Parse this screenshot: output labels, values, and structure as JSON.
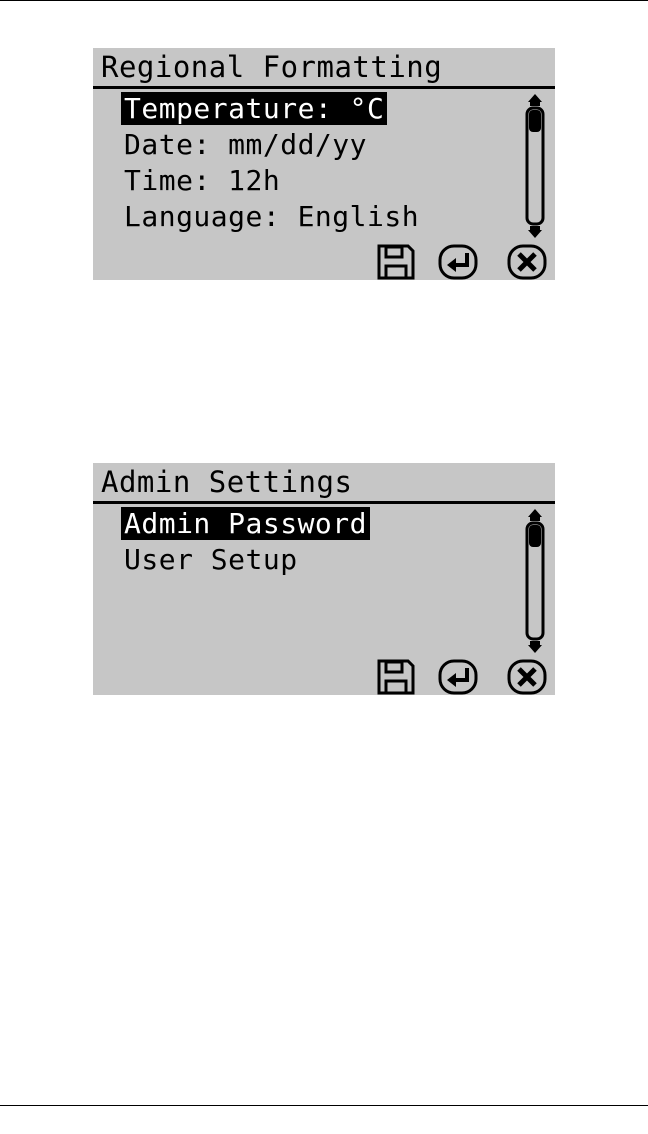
{
  "screens": [
    {
      "title": "Regional Formatting",
      "items": [
        {
          "label": "Temperature: °C",
          "selected": true
        },
        {
          "label": "Date: mm/dd/yy",
          "selected": false
        },
        {
          "label": "Time: 12h",
          "selected": false
        },
        {
          "label": "Language: English",
          "selected": false
        }
      ],
      "softkeys": [
        "save-icon",
        "enter-icon",
        "close-icon"
      ]
    },
    {
      "title": "Admin Settings",
      "items": [
        {
          "label": "Admin Password",
          "selected": true
        },
        {
          "label": "User Setup",
          "selected": false
        }
      ],
      "softkeys": [
        "save-icon",
        "enter-icon",
        "close-icon"
      ]
    }
  ],
  "colors": {
    "lcd_background": "#c6c6c6",
    "lcd_ink": "#000000",
    "selection_text": "#ffffff"
  }
}
